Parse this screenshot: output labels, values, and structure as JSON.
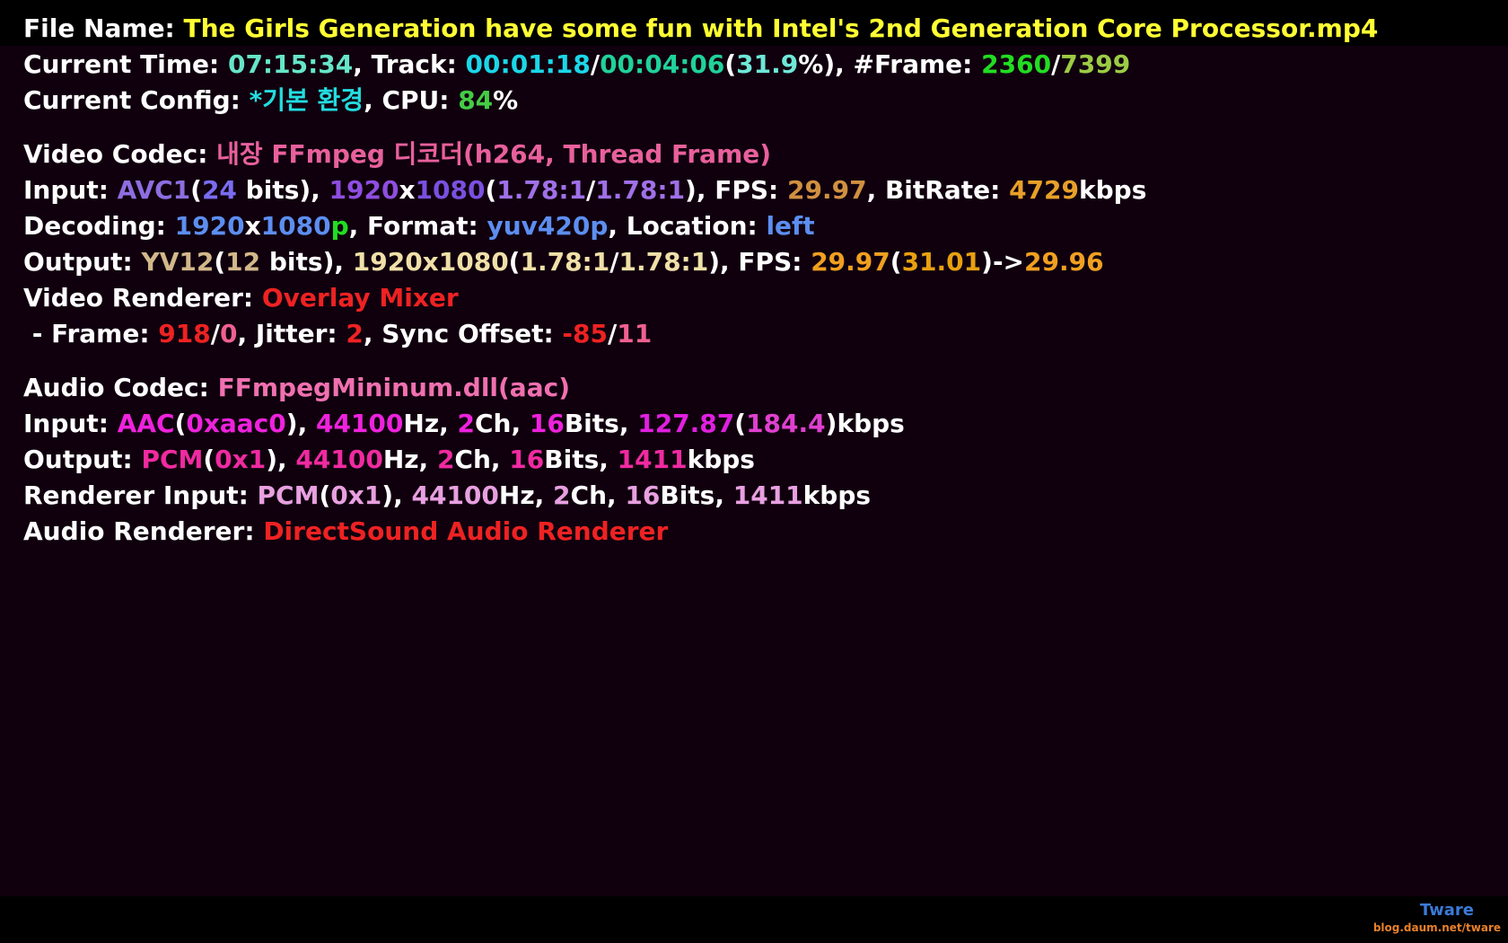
{
  "lines": [
    [
      {
        "t": "File Name: ",
        "c": "#ffffff"
      },
      {
        "t": "The Girls Generation have some fun with Intel's 2nd Generation Core Processor.mp4",
        "c": "#ffff33"
      }
    ],
    [
      {
        "t": "Current Time: ",
        "c": "#ffffff"
      },
      {
        "t": "07:15:34",
        "c": "#66e6c8"
      },
      {
        "t": ", Track: ",
        "c": "#ffffff"
      },
      {
        "t": "00:01:18",
        "c": "#1ad7e8"
      },
      {
        "t": "/",
        "c": "#ffffff"
      },
      {
        "t": "00:04:06",
        "c": "#20d29a"
      },
      {
        "t": "(",
        "c": "#ffffff"
      },
      {
        "t": "31.9",
        "c": "#6fe8d8"
      },
      {
        "t": "%), #Frame: ",
        "c": "#ffffff"
      },
      {
        "t": "2360",
        "c": "#22dd22"
      },
      {
        "t": "/",
        "c": "#ffffff"
      },
      {
        "t": "7399",
        "c": "#9ccc44"
      }
    ],
    [
      {
        "t": "Current Config: ",
        "c": "#ffffff"
      },
      {
        "t": "*기본 환경",
        "c": "#22dde0"
      },
      {
        "t": ", CPU: ",
        "c": "#ffffff"
      },
      {
        "t": "84",
        "c": "#44cc44"
      },
      {
        "t": "%",
        "c": "#ffffff"
      }
    ],
    null,
    [
      {
        "t": "Video Codec: ",
        "c": "#ffffff"
      },
      {
        "t": "내장 FFmpeg 디코더(h264, Thread Frame)",
        "c": "#e8609c"
      }
    ],
    [
      {
        "t": "Input: ",
        "c": "#ffffff"
      },
      {
        "t": "AVC1",
        "c": "#8c6ee0"
      },
      {
        "t": "(",
        "c": "#ffffff"
      },
      {
        "t": "24",
        "c": "#7a6cf0"
      },
      {
        "t": " bits), ",
        "c": "#ffffff"
      },
      {
        "t": "1920",
        "c": "#8e4ee0"
      },
      {
        "t": "x",
        "c": "#ffffff"
      },
      {
        "t": "1080",
        "c": "#7a50e0"
      },
      {
        "t": "(",
        "c": "#ffffff"
      },
      {
        "t": "1.78:1",
        "c": "#a070e8"
      },
      {
        "t": "/",
        "c": "#ffffff"
      },
      {
        "t": "1.78:1",
        "c": "#a070e8"
      },
      {
        "t": "), FPS: ",
        "c": "#ffffff"
      },
      {
        "t": "29.97",
        "c": "#d09040"
      },
      {
        "t": ", BitRate: ",
        "c": "#ffffff"
      },
      {
        "t": "4729",
        "c": "#e8a028"
      },
      {
        "t": "kbps",
        "c": "#ffffff"
      }
    ],
    [
      {
        "t": "Decoding: ",
        "c": "#ffffff"
      },
      {
        "t": "1920",
        "c": "#5c8ef0"
      },
      {
        "t": "x",
        "c": "#ffffff"
      },
      {
        "t": "1080",
        "c": "#5c8ef0"
      },
      {
        "t": "p",
        "c": "#22dd22"
      },
      {
        "t": ", Format: ",
        "c": "#ffffff"
      },
      {
        "t": "yuv420p",
        "c": "#5c8ef0"
      },
      {
        "t": ", Location: ",
        "c": "#ffffff"
      },
      {
        "t": "left",
        "c": "#5c8ef0"
      }
    ],
    [
      {
        "t": "Output: ",
        "c": "#ffffff"
      },
      {
        "t": "YV12",
        "c": "#d2b88a"
      },
      {
        "t": "(",
        "c": "#ffffff"
      },
      {
        "t": "12",
        "c": "#d2b88a"
      },
      {
        "t": " bits), ",
        "c": "#ffffff"
      },
      {
        "t": "1920x1080",
        "c": "#f0e0a8"
      },
      {
        "t": "(",
        "c": "#ffffff"
      },
      {
        "t": "1.78:1",
        "c": "#f0e0a8"
      },
      {
        "t": "/",
        "c": "#ffffff"
      },
      {
        "t": "1.78:1",
        "c": "#f0e0a8"
      },
      {
        "t": "), FPS: ",
        "c": "#ffffff"
      },
      {
        "t": "29.97",
        "c": "#f0a020"
      },
      {
        "t": "(",
        "c": "#ffffff"
      },
      {
        "t": "31.01",
        "c": "#e8a010"
      },
      {
        "t": ")->",
        "c": "#ffffff"
      },
      {
        "t": "29.96",
        "c": "#f0a020"
      }
    ],
    [
      {
        "t": "Video Renderer: ",
        "c": "#ffffff"
      },
      {
        "t": "Overlay Mixer",
        "c": "#ee2222"
      }
    ],
    [
      {
        "t": " - Frame: ",
        "c": "#ffffff"
      },
      {
        "t": "918",
        "c": "#ee2222"
      },
      {
        "t": "/",
        "c": "#ffffff"
      },
      {
        "t": "0",
        "c": "#f06090"
      },
      {
        "t": ", Jitter: ",
        "c": "#ffffff"
      },
      {
        "t": "2",
        "c": "#ee2222"
      },
      {
        "t": ", Sync Offset: ",
        "c": "#ffffff"
      },
      {
        "t": "-85",
        "c": "#ee2222"
      },
      {
        "t": "/",
        "c": "#ffffff"
      },
      {
        "t": "11",
        "c": "#f06090"
      }
    ],
    null,
    [
      {
        "t": "Audio Codec: ",
        "c": "#ffffff"
      },
      {
        "t": "FFmpegMininum.dll(aac)",
        "c": "#f070b0"
      }
    ],
    [
      {
        "t": "Input: ",
        "c": "#ffffff"
      },
      {
        "t": "AAC",
        "c": "#ee22dd"
      },
      {
        "t": "(",
        "c": "#ffffff"
      },
      {
        "t": "0xaac0",
        "c": "#ee22dd"
      },
      {
        "t": "), ",
        "c": "#ffffff"
      },
      {
        "t": "44100",
        "c": "#ee22dd"
      },
      {
        "t": "Hz, ",
        "c": "#ffffff"
      },
      {
        "t": "2",
        "c": "#ee22dd"
      },
      {
        "t": "Ch, ",
        "c": "#ffffff"
      },
      {
        "t": "16",
        "c": "#ee22dd"
      },
      {
        "t": "Bits, ",
        "c": "#ffffff"
      },
      {
        "t": "127.87",
        "c": "#e020e0"
      },
      {
        "t": "(",
        "c": "#ffffff"
      },
      {
        "t": "184.4",
        "c": "#e040d0"
      },
      {
        "t": ")kbps",
        "c": "#ffffff"
      }
    ],
    [
      {
        "t": "Output: ",
        "c": "#ffffff"
      },
      {
        "t": "PCM",
        "c": "#f02aa0"
      },
      {
        "t": "(",
        "c": "#ffffff"
      },
      {
        "t": "0x1",
        "c": "#f02aa0"
      },
      {
        "t": "), ",
        "c": "#ffffff"
      },
      {
        "t": "44100",
        "c": "#f02aa0"
      },
      {
        "t": "Hz, ",
        "c": "#ffffff"
      },
      {
        "t": "2",
        "c": "#f02aa0"
      },
      {
        "t": "Ch, ",
        "c": "#ffffff"
      },
      {
        "t": "16",
        "c": "#f02aa0"
      },
      {
        "t": "Bits, ",
        "c": "#ffffff"
      },
      {
        "t": "1411",
        "c": "#f02aa0"
      },
      {
        "t": "kbps",
        "c": "#ffffff"
      }
    ],
    [
      {
        "t": "Renderer Input: ",
        "c": "#ffffff"
      },
      {
        "t": "PCM",
        "c": "#e8a0e0"
      },
      {
        "t": "(",
        "c": "#ffffff"
      },
      {
        "t": "0x1",
        "c": "#e8a0e0"
      },
      {
        "t": "), ",
        "c": "#ffffff"
      },
      {
        "t": "44100",
        "c": "#e8a0e0"
      },
      {
        "t": "Hz, ",
        "c": "#ffffff"
      },
      {
        "t": "2",
        "c": "#e8a0e0"
      },
      {
        "t": "Ch, ",
        "c": "#ffffff"
      },
      {
        "t": "16",
        "c": "#e8a0e0"
      },
      {
        "t": "Bits, ",
        "c": "#ffffff"
      },
      {
        "t": "1411",
        "c": "#e8a0e0"
      },
      {
        "t": "kbps",
        "c": "#ffffff"
      }
    ],
    [
      {
        "t": "Audio Renderer: ",
        "c": "#ffffff"
      },
      {
        "t": "DirectSound Audio Renderer",
        "c": "#ee2222"
      }
    ]
  ],
  "watermark": {
    "name": "Tware",
    "name_color": "#3a7ad8",
    "url": "blog.daum.net/tware",
    "url_color": "#e8802a"
  }
}
